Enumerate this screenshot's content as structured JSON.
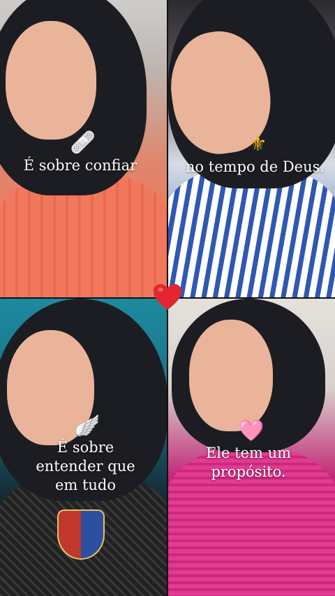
{
  "captions": {
    "top_left": "É sobre confiar",
    "top_right": "no tempo de Deus.",
    "bottom_left_1": "É sobre",
    "bottom_left_2": "entender que",
    "bottom_left_3": "em tudo",
    "bottom_right_1": "Ele tem um",
    "bottom_right_2": "propósito."
  },
  "stickers": {
    "bandage": "🩹",
    "fleur": "⚜",
    "wing": "🪽",
    "pink_heart": "🩷"
  },
  "colors": {
    "caption_text": "#ffffff",
    "heart_red": "#e3262f",
    "fleur_gold": "#f2b61a"
  }
}
